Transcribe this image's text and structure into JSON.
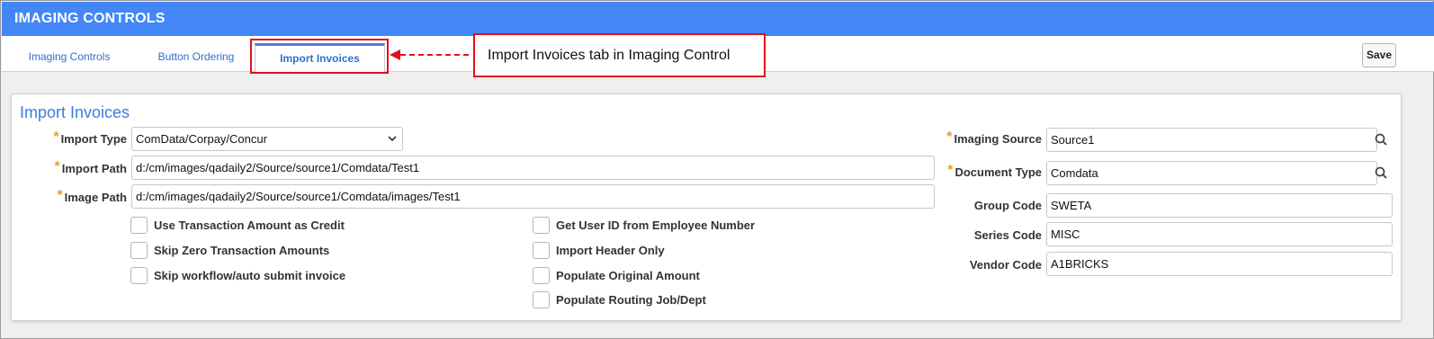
{
  "app": {
    "title": "IMAGING CONTROLS"
  },
  "tabs": [
    {
      "label": "Imaging Controls"
    },
    {
      "label": "Button Ordering"
    },
    {
      "label": "Import Invoices"
    }
  ],
  "annotation": {
    "callout_text": "Import Invoices tab in Imaging Control"
  },
  "toolbar": {
    "save_label": "Save"
  },
  "panel": {
    "title": "Import Invoices",
    "import_type": {
      "label": "Import Type",
      "value": "ComData/Corpay/Concur"
    },
    "import_path": {
      "label": "Import Path",
      "value": "d:/cm/images/qadaily2/Source/source1/Comdata/Test1"
    },
    "image_path": {
      "label": "Image Path",
      "value": "d:/cm/images/qadaily2/Source/source1/Comdata/images/Test1"
    },
    "checkboxes_left": [
      {
        "label": "Use Transaction Amount as Credit",
        "checked": false
      },
      {
        "label": "Skip Zero Transaction Amounts",
        "checked": false
      },
      {
        "label": "Skip workflow/auto submit invoice",
        "checked": false
      }
    ],
    "checkboxes_right": [
      {
        "label": "Get User ID from Employee Number",
        "checked": false
      },
      {
        "label": "Import Header Only",
        "checked": false
      },
      {
        "label": "Populate Original Amount",
        "checked": false
      },
      {
        "label": "Populate Routing Job/Dept",
        "checked": false
      }
    ],
    "imaging_source": {
      "label": "Imaging Source",
      "value": "Source1"
    },
    "document_type": {
      "label": "Document Type",
      "value": "Comdata"
    },
    "group_code": {
      "label": "Group Code",
      "value": "SWETA"
    },
    "series_code": {
      "label": "Series Code",
      "value": "MISC"
    },
    "vendor_code": {
      "label": "Vendor Code",
      "value": "A1BRICKS"
    }
  },
  "colors": {
    "header_bg": "#4287f5",
    "accent_blue": "#3b7ee0",
    "required_star": "#f29e1a",
    "annotation_red": "#e0101a"
  }
}
